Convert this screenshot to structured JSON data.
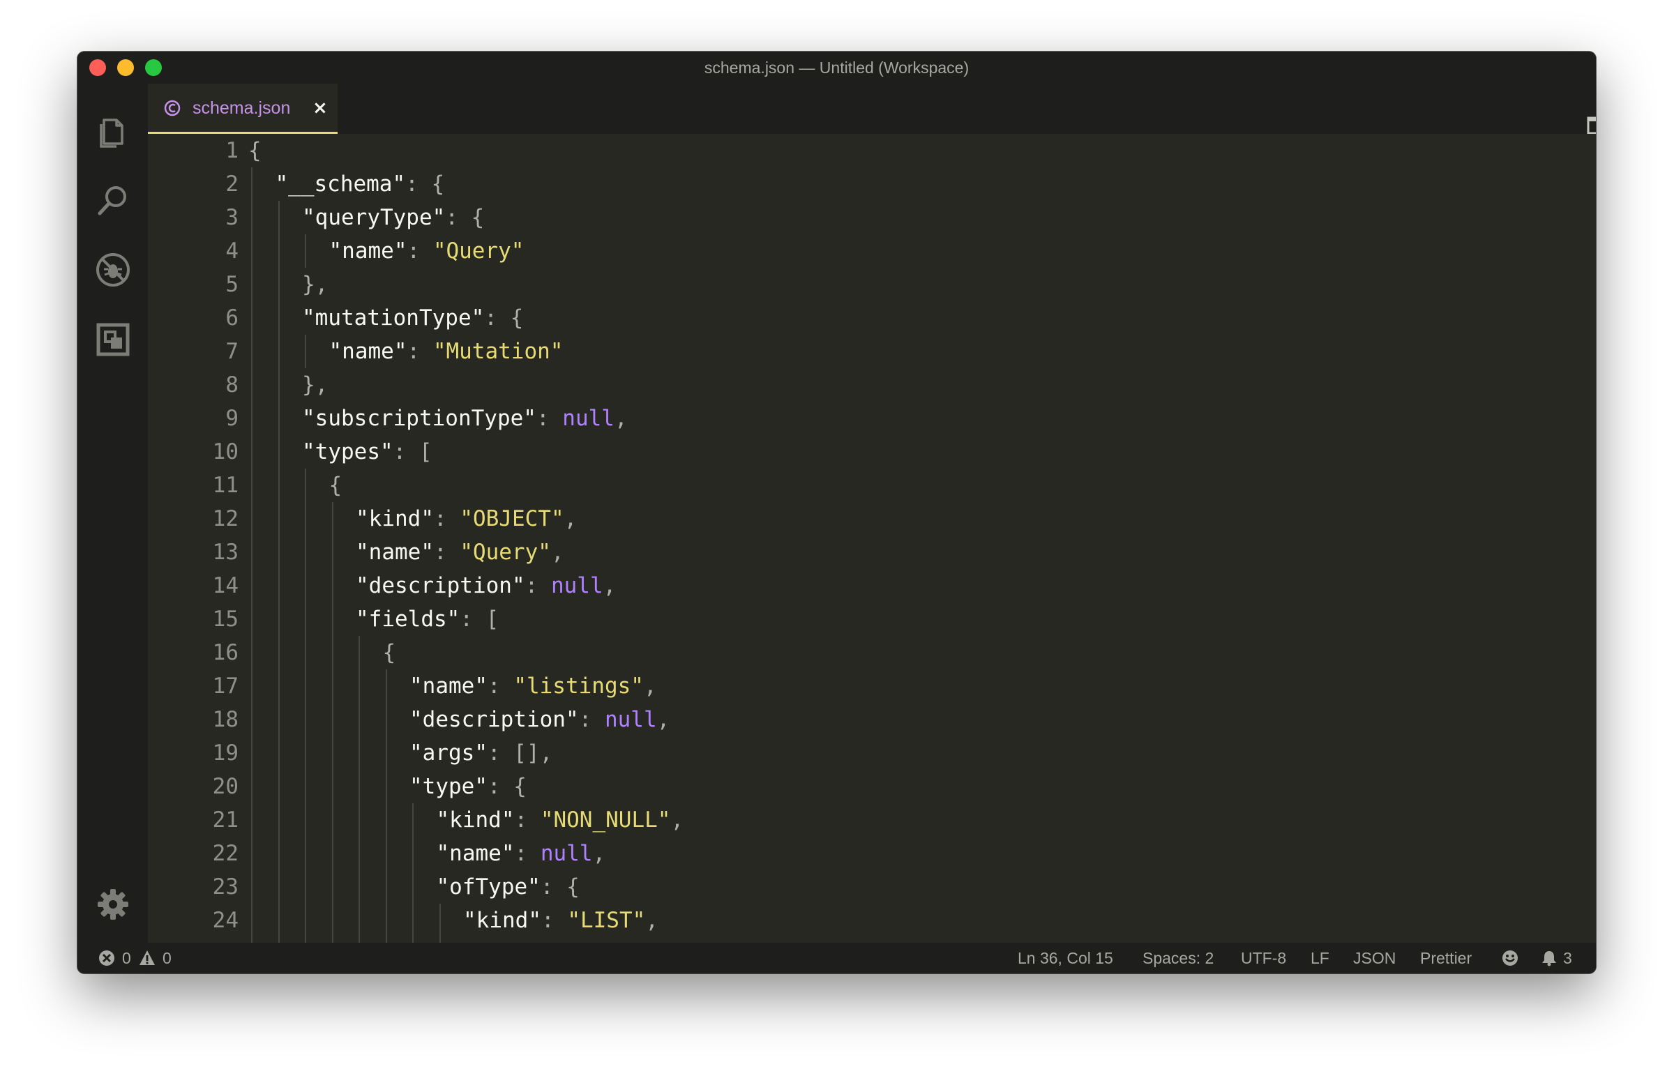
{
  "window": {
    "title": "schema.json — Untitled (Workspace)"
  },
  "activity_bar": {
    "items": [
      {
        "icon": "files-icon"
      },
      {
        "icon": "search-icon"
      },
      {
        "icon": "debug-icon"
      },
      {
        "icon": "extensions-icon"
      }
    ],
    "bottom_icon": "gear-icon"
  },
  "tabs": [
    {
      "label": "schema.json",
      "icon": "graphql-icon",
      "close": "×",
      "active": true
    }
  ],
  "editor_actions": {
    "split_icon": "split-editor-icon",
    "more": "···"
  },
  "editor": {
    "lines": [
      {
        "n": "1",
        "indent": 0,
        "tokens": [
          [
            "p",
            "{"
          ]
        ]
      },
      {
        "n": "2",
        "indent": 1,
        "tokens": [
          [
            "k",
            "\"__schema\""
          ],
          [
            "p",
            ": {"
          ]
        ]
      },
      {
        "n": "3",
        "indent": 2,
        "tokens": [
          [
            "k",
            "\"queryType\""
          ],
          [
            "p",
            ": {"
          ]
        ]
      },
      {
        "n": "4",
        "indent": 3,
        "tokens": [
          [
            "k",
            "\"name\""
          ],
          [
            "p",
            ": "
          ],
          [
            "s",
            "\"Query\""
          ]
        ]
      },
      {
        "n": "5",
        "indent": 2,
        "tokens": [
          [
            "p",
            "},"
          ]
        ]
      },
      {
        "n": "6",
        "indent": 2,
        "tokens": [
          [
            "k",
            "\"mutationType\""
          ],
          [
            "p",
            ": {"
          ]
        ]
      },
      {
        "n": "7",
        "indent": 3,
        "tokens": [
          [
            "k",
            "\"name\""
          ],
          [
            "p",
            ": "
          ],
          [
            "s",
            "\"Mutation\""
          ]
        ]
      },
      {
        "n": "8",
        "indent": 2,
        "tokens": [
          [
            "p",
            "},"
          ]
        ]
      },
      {
        "n": "9",
        "indent": 2,
        "tokens": [
          [
            "k",
            "\"subscriptionType\""
          ],
          [
            "p",
            ": "
          ],
          [
            "n",
            "null"
          ],
          [
            "p",
            ","
          ]
        ]
      },
      {
        "n": "10",
        "indent": 2,
        "tokens": [
          [
            "k",
            "\"types\""
          ],
          [
            "p",
            ": ["
          ]
        ]
      },
      {
        "n": "11",
        "indent": 3,
        "tokens": [
          [
            "p",
            "{"
          ]
        ]
      },
      {
        "n": "12",
        "indent": 4,
        "tokens": [
          [
            "k",
            "\"kind\""
          ],
          [
            "p",
            ": "
          ],
          [
            "s",
            "\"OBJECT\""
          ],
          [
            "p",
            ","
          ]
        ]
      },
      {
        "n": "13",
        "indent": 4,
        "tokens": [
          [
            "k",
            "\"name\""
          ],
          [
            "p",
            ": "
          ],
          [
            "s",
            "\"Query\""
          ],
          [
            "p",
            ","
          ]
        ]
      },
      {
        "n": "14",
        "indent": 4,
        "tokens": [
          [
            "k",
            "\"description\""
          ],
          [
            "p",
            ": "
          ],
          [
            "n",
            "null"
          ],
          [
            "p",
            ","
          ]
        ]
      },
      {
        "n": "15",
        "indent": 4,
        "tokens": [
          [
            "k",
            "\"fields\""
          ],
          [
            "p",
            ": ["
          ]
        ]
      },
      {
        "n": "16",
        "indent": 5,
        "tokens": [
          [
            "p",
            "{"
          ]
        ]
      },
      {
        "n": "17",
        "indent": 6,
        "tokens": [
          [
            "k",
            "\"name\""
          ],
          [
            "p",
            ": "
          ],
          [
            "s",
            "\"listings\""
          ],
          [
            "p",
            ","
          ]
        ]
      },
      {
        "n": "18",
        "indent": 6,
        "tokens": [
          [
            "k",
            "\"description\""
          ],
          [
            "p",
            ": "
          ],
          [
            "n",
            "null"
          ],
          [
            "p",
            ","
          ]
        ]
      },
      {
        "n": "19",
        "indent": 6,
        "tokens": [
          [
            "k",
            "\"args\""
          ],
          [
            "p",
            ": [],"
          ]
        ]
      },
      {
        "n": "20",
        "indent": 6,
        "tokens": [
          [
            "k",
            "\"type\""
          ],
          [
            "p",
            ": {"
          ]
        ]
      },
      {
        "n": "21",
        "indent": 7,
        "tokens": [
          [
            "k",
            "\"kind\""
          ],
          [
            "p",
            ": "
          ],
          [
            "s",
            "\"NON_NULL\""
          ],
          [
            "p",
            ","
          ]
        ]
      },
      {
        "n": "22",
        "indent": 7,
        "tokens": [
          [
            "k",
            "\"name\""
          ],
          [
            "p",
            ": "
          ],
          [
            "n",
            "null"
          ],
          [
            "p",
            ","
          ]
        ]
      },
      {
        "n": "23",
        "indent": 7,
        "tokens": [
          [
            "k",
            "\"ofType\""
          ],
          [
            "p",
            ": {"
          ]
        ]
      },
      {
        "n": "24",
        "indent": 8,
        "tokens": [
          [
            "k",
            "\"kind\""
          ],
          [
            "p",
            ": "
          ],
          [
            "s",
            "\"LIST\""
          ],
          [
            "p",
            ","
          ]
        ]
      }
    ]
  },
  "status_bar": {
    "errors": "0",
    "warnings": "0",
    "position": "Ln 36, Col 15",
    "spaces": "Spaces: 2",
    "encoding": "UTF-8",
    "eol": "LF",
    "language": "JSON",
    "formatter": "Prettier",
    "feedback_icon": "smiley-icon",
    "notifications": "3"
  },
  "colors": {
    "background": "#272822",
    "chrome": "#1e1f1c",
    "string": "#e6db74",
    "null": "#ae81ff",
    "tab_label": "#c792ea",
    "tab_underline": "#e6db74"
  }
}
